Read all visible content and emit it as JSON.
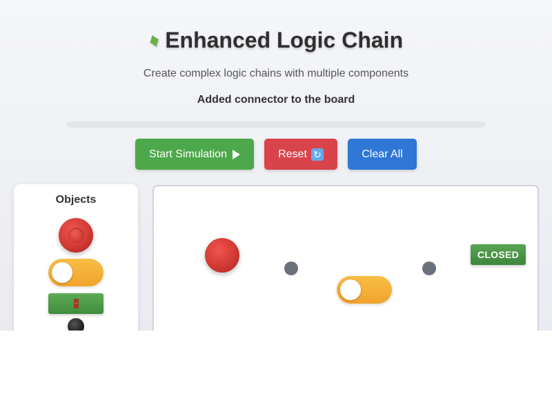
{
  "header": {
    "title_icon": "puzzle-piece-icon",
    "title": "Enhanced Logic Chain",
    "subtitle": "Create complex logic chains with multiple components",
    "status": "Added connector to the board"
  },
  "progress": {
    "value": 0,
    "color": "#4caf50"
  },
  "toolbar": {
    "start_label": "Start Simulation",
    "start_icon": "play-icon",
    "reset_label": "Reset",
    "reset_icon": "refresh-icon",
    "clear_label": "Clear All",
    "colors": {
      "start": "#4ca84a",
      "reset": "#d9434a",
      "clear": "#2e77d6"
    }
  },
  "objects_panel": {
    "title": "Objects",
    "items": [
      {
        "type": "red-button",
        "icon": "red-button-icon"
      },
      {
        "type": "toggle-switch",
        "icon": "toggle-icon",
        "state": "off"
      },
      {
        "type": "door-block",
        "icon": "door-icon"
      },
      {
        "type": "black-ball",
        "icon": "ball-icon"
      }
    ]
  },
  "board": {
    "components": [
      {
        "type": "red-button"
      },
      {
        "type": "connector"
      },
      {
        "type": "toggle-switch",
        "state": "off"
      },
      {
        "type": "connector"
      },
      {
        "type": "door-block",
        "label": "CLOSED"
      }
    ]
  }
}
